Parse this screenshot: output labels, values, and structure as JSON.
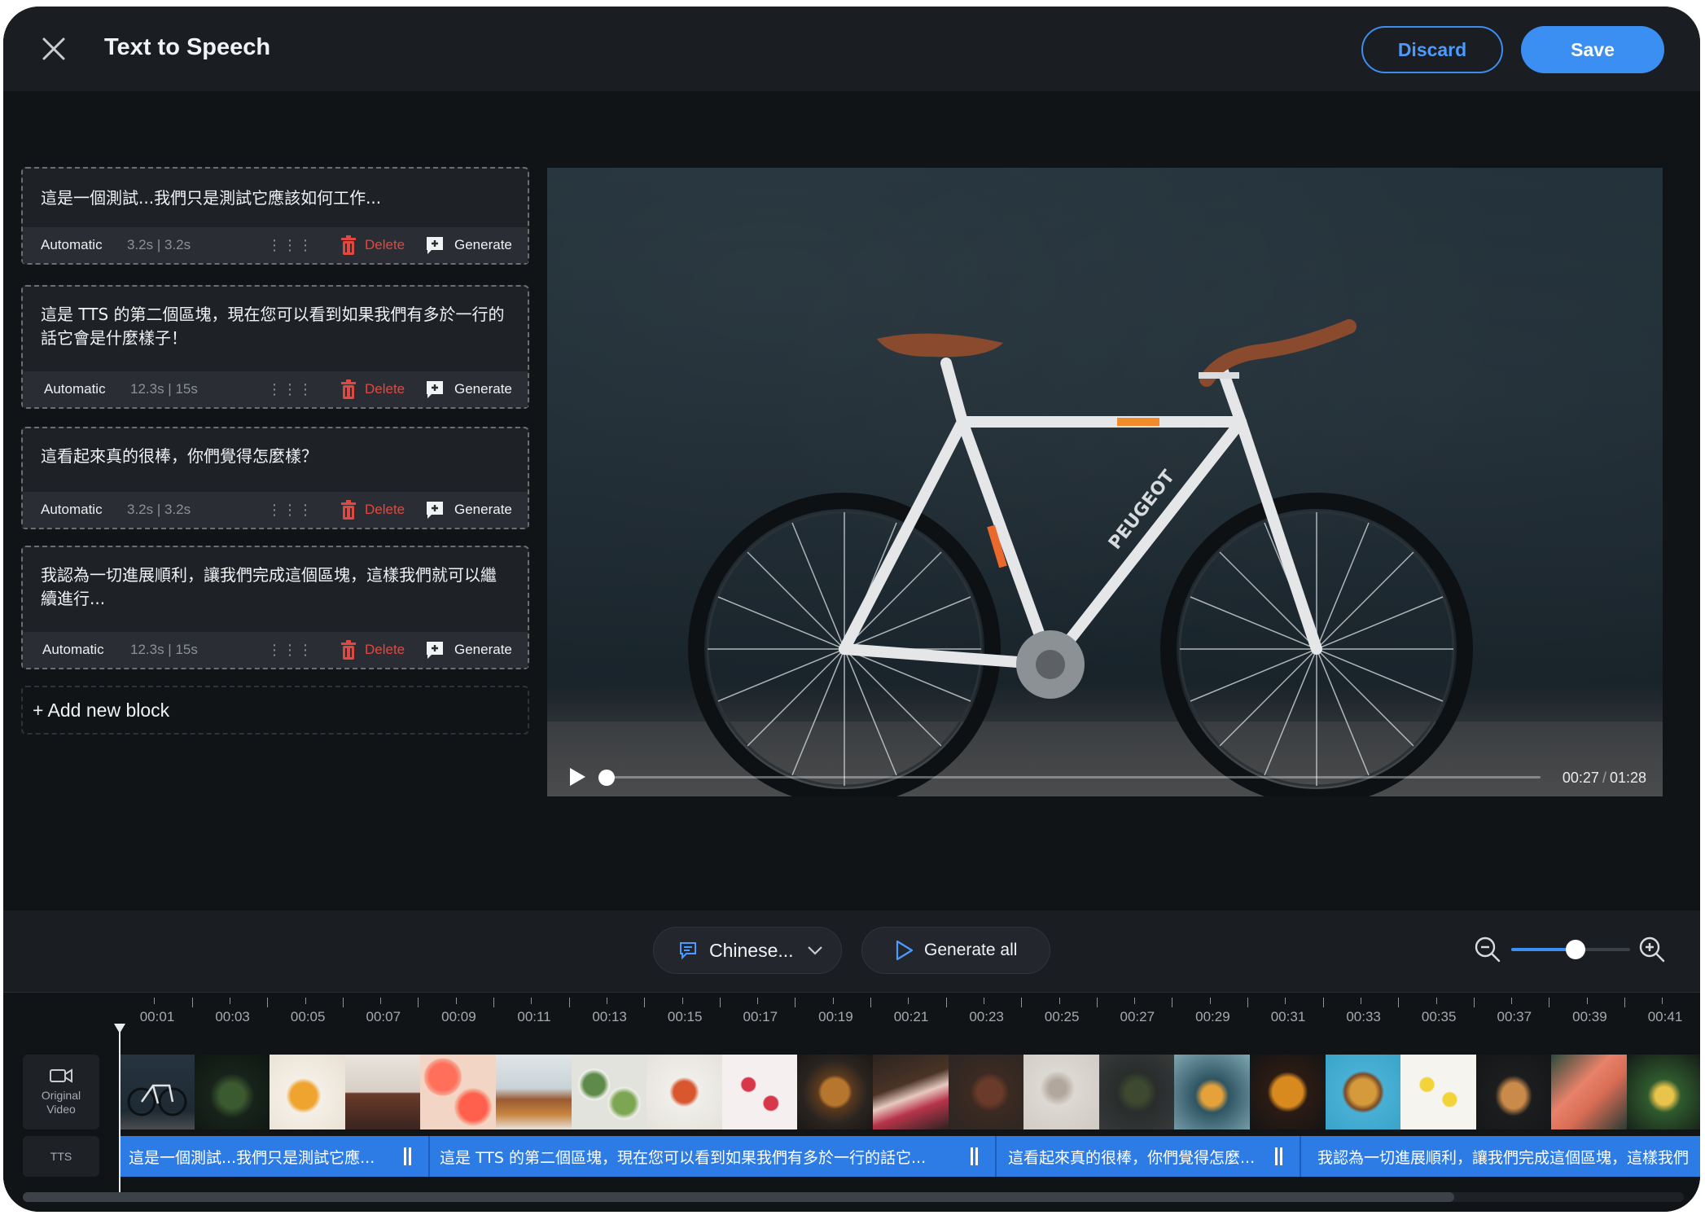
{
  "header": {
    "title": "Text to Speech",
    "discard_label": "Discard",
    "save_label": "Save",
    "accent": "#3b8ff3"
  },
  "blocks": [
    {
      "text_line1": "這是一個測試...我們只是測試它應該如何工作...",
      "text_line2": "",
      "mode": "Automatic",
      "duration": "3.2s | 3.2s",
      "delete_label": "Delete",
      "generate_label": "Generate"
    },
    {
      "text_line1": "這是 TTS 的第二個區塊，現在您可以看到如果我們有多於一行的",
      "text_line2": "話它會是什麼樣子！",
      "mode": "Automatic",
      "duration": "12.3s | 15s",
      "delete_label": "Delete",
      "generate_label": "Generate"
    },
    {
      "text_line1": "這看起來真的很棒，你們覺得怎麼樣？",
      "text_line2": "",
      "mode": "Automatic",
      "duration": "3.2s | 3.2s",
      "delete_label": "Delete",
      "generate_label": "Generate"
    },
    {
      "text_line1": "我認為一切進展順利，讓我們完成這個區塊，這樣我們就可以繼",
      "text_line2": "續進行...",
      "mode": "Automatic",
      "duration": "12.3s | 15s",
      "delete_label": "Delete",
      "generate_label": "Generate"
    }
  ],
  "add_block_label": "+ Add new block",
  "video": {
    "current_time": "00:27",
    "separator": "/",
    "total_time": "01:28",
    "progress": 0.0
  },
  "toolbar": {
    "language_label": "Chinese...",
    "generate_all_label": "Generate all",
    "zoom_level": 0.54
  },
  "timeline": {
    "ticks": [
      "00:01",
      "00:03",
      "00:05",
      "00:07",
      "00:09",
      "00:11",
      "00:13",
      "00:15",
      "00:17",
      "00:19",
      "00:21",
      "00:23",
      "00:25",
      "00:27",
      "00:29",
      "00:31",
      "00:33",
      "00:35",
      "00:37",
      "00:39",
      "00:41"
    ],
    "original_video_label_line1": "Original",
    "original_video_label_line2": "Video",
    "tts_label": "TTS",
    "tts_segments": [
      "這是一個測試...我們只是測試它應...",
      "這是 TTS 的第二個區塊，現在您可以看到如果我們有多於一行的話它...",
      "這看起來真的很棒，你們覺得怎麼...",
      "我認為一切進展順利，讓我們完成這個區塊，這樣我們"
    ]
  }
}
